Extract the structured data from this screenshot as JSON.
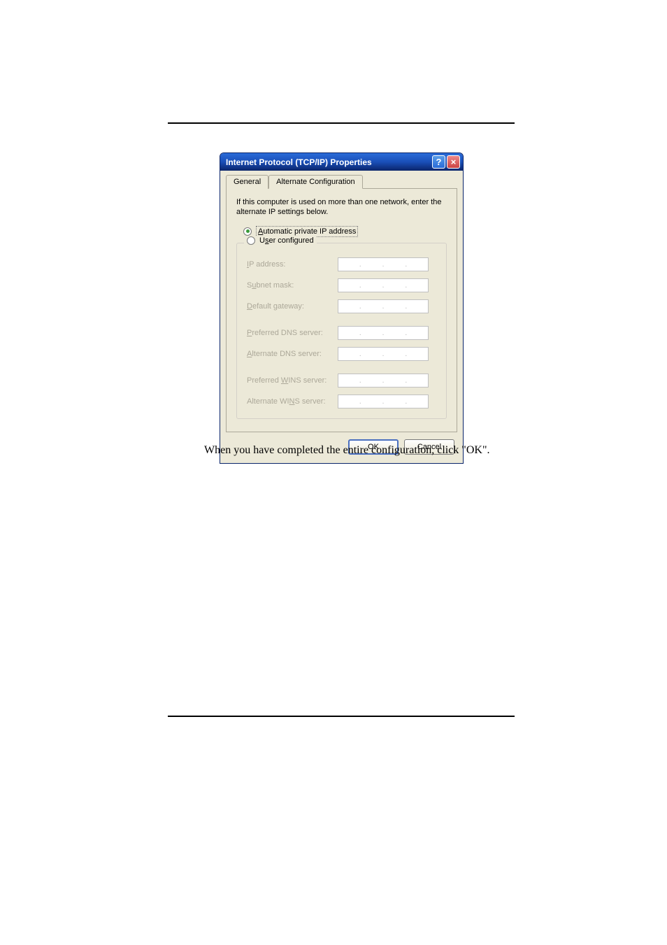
{
  "dialog": {
    "title": "Internet Protocol (TCP/IP) Properties",
    "help_label": "?",
    "close_label": "×",
    "tabs": {
      "general": "General",
      "alternate": "Alternate Configuration"
    },
    "instruction": "If this computer is used on more than one network, enter the alternate IP settings below.",
    "radio_auto": "Automatic private IP address",
    "radio_user": "User configured",
    "fields": {
      "ip": "IP address:",
      "subnet": "Subnet mask:",
      "gateway": "Default gateway:",
      "pref_dns": "Preferred DNS server:",
      "alt_dns": "Alternate DNS server:",
      "pref_wins": "Preferred WINS server:",
      "alt_wins": "Alternate WINS server:"
    },
    "buttons": {
      "ok": "OK",
      "cancel": "Cancel"
    }
  },
  "caption": "When you have completed the entire configuration, click \"OK\"."
}
